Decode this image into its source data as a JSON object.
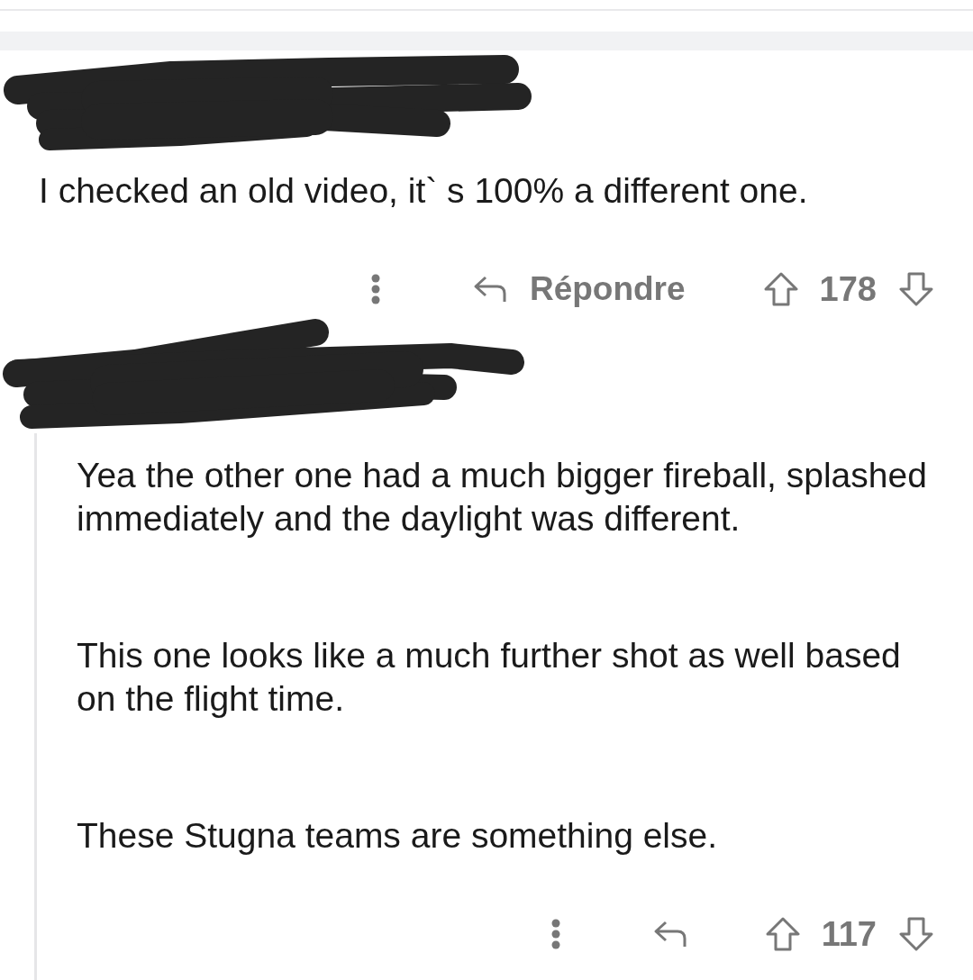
{
  "comments": [
    {
      "thread_line": false,
      "paragraphs": [
        "I checked an old video, it` s 100% a different one."
      ],
      "actions": {
        "reply_label": "Répondre",
        "score": "178"
      }
    },
    {
      "thread_line": true,
      "paragraphs": [
        "Yea the other one had a much bigger fireball, splashed immediately and the daylight was different.",
        "This one looks like a much further shot as well based on the flight time.",
        "These Stugna teams are something else."
      ],
      "actions": {
        "score": "117"
      }
    }
  ]
}
